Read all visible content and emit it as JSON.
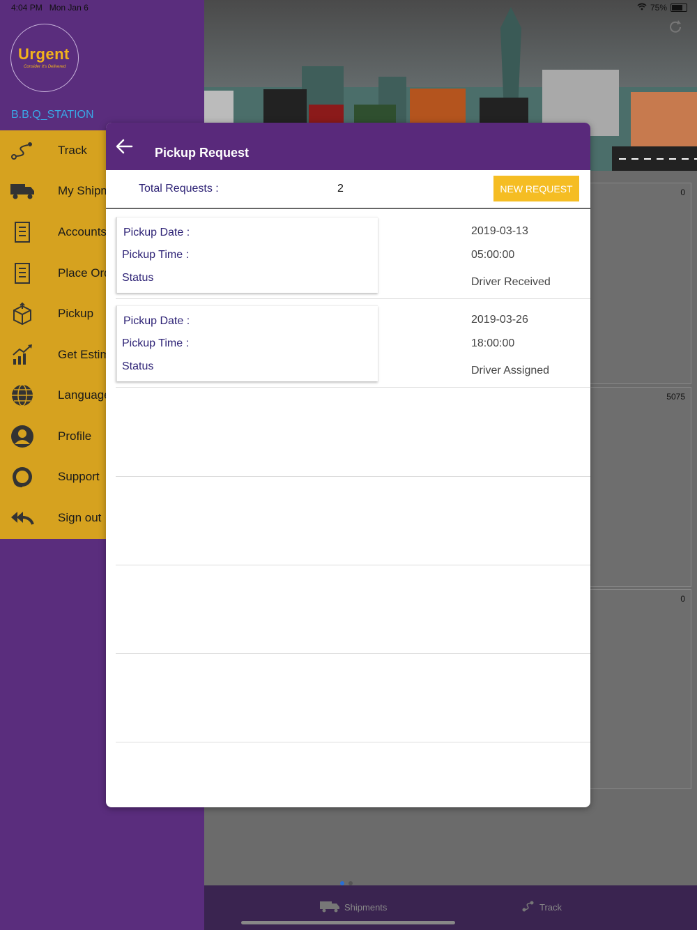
{
  "status_bar": {
    "time": "4:04 PM",
    "date": "Mon Jan 6",
    "battery": "75%"
  },
  "sidebar": {
    "brand": "Urgent",
    "tagline": "Consider It's Delivered",
    "account_name": "B.B.Q_STATION",
    "items": [
      {
        "label": "Track",
        "icon": "route-icon"
      },
      {
        "label": "My Shipm",
        "icon": "truck-icon"
      },
      {
        "label": "Accounts",
        "icon": "document-icon"
      },
      {
        "label": "Place Ord",
        "icon": "document-list-icon"
      },
      {
        "label": "Pickup",
        "icon": "box-icon"
      },
      {
        "label": "Get Estim",
        "icon": "growth-chart-icon"
      },
      {
        "label": "Language",
        "icon": "globe-icon"
      },
      {
        "label": "Profile",
        "icon": "user-icon"
      },
      {
        "label": "Support",
        "icon": "headset-icon"
      },
      {
        "label": "Sign out",
        "icon": "reply-all-icon"
      }
    ]
  },
  "modal": {
    "title": "Pickup Request",
    "total_label": "Total Requests :",
    "total_value": "2",
    "new_request_label": "NEW REQUEST",
    "requests": [
      {
        "date_label": "Pickup Date :",
        "date": "2019-03-13",
        "time_label": "Pickup Time :",
        "time": "05:00:00",
        "status_label": "Status",
        "status": "Driver Received"
      },
      {
        "date_label": "Pickup Date :",
        "date": "2019-03-26",
        "time_label": "Pickup Time :",
        "time": "18:00:00",
        "status_label": "Status",
        "status": "Driver Assigned"
      }
    ]
  },
  "background": {
    "panel_values": [
      "0",
      "5075",
      "0"
    ],
    "tabs": [
      {
        "label": "Shipments"
      },
      {
        "label": "Track"
      }
    ]
  },
  "colors": {
    "purple": "#59297b",
    "gold": "#d6a21f",
    "button_yellow": "#f5bd23",
    "label_navy": "#2e2376",
    "link_blue": "#3aa7e6"
  }
}
